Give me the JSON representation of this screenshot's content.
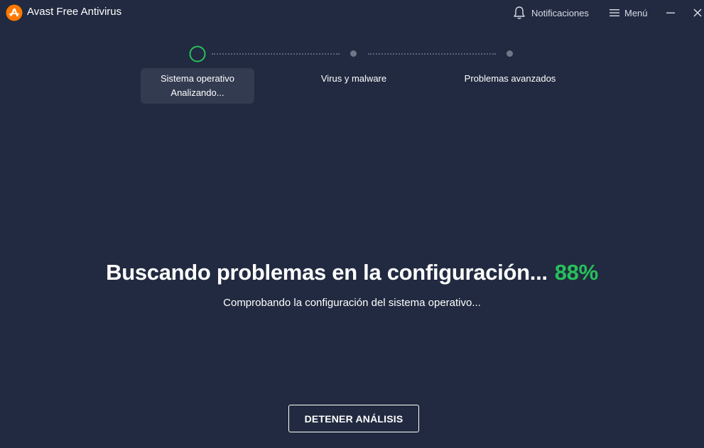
{
  "app": {
    "title": "Avast Free Antivirus",
    "logo_icon": "avast-logo-icon",
    "brand_color": "#ff7800"
  },
  "header": {
    "notifications_label": "Notificaciones",
    "notifications_icon": "bell-icon",
    "menu_label": "Menú",
    "menu_icon": "hamburger-icon",
    "window_controls": [
      "minimize-icon",
      "close-icon"
    ]
  },
  "stepper": {
    "steps": [
      {
        "label": "Sistema operativo",
        "status": "Analizando...",
        "state": "active"
      },
      {
        "label": "Virus y malware",
        "status": "",
        "state": "pending"
      },
      {
        "label": "Problemas avanzados",
        "status": "",
        "state": "pending"
      }
    ],
    "active_color": "#28c05a"
  },
  "scan": {
    "headline": "Buscando problemas en la configuración...",
    "percent": "88%",
    "progress": 0.88,
    "detail": "Comprobando la configuración del sistema operativo..."
  },
  "actions": {
    "stop_label": "DETENER ANÁLISIS"
  },
  "colors": {
    "background": "#212a40",
    "accent_green": "#28c05a",
    "card": "#333b51"
  }
}
